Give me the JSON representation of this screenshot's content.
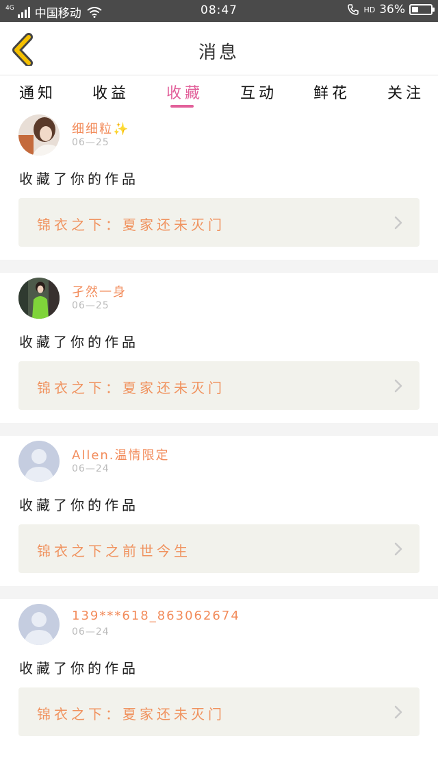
{
  "status_bar": {
    "network": "4G",
    "carrier": "中国移动",
    "time": "08:47",
    "hd": "HD",
    "battery_text": "36%",
    "battery_level": 0.36
  },
  "nav": {
    "title": "消息",
    "back_icon": "back-chevron-icon",
    "accent": "#f5c000"
  },
  "tabs": [
    {
      "label": "通知"
    },
    {
      "label": "收益"
    },
    {
      "label": "收藏",
      "active": true
    },
    {
      "label": "互动"
    },
    {
      "label": "鲜花"
    },
    {
      "label": "关注"
    }
  ],
  "colors": {
    "active_tab": "#e2609a",
    "username": "#f28b5a",
    "work_title": "#f0925e",
    "work_box_bg": "#f2f2ec"
  },
  "feed": [
    {
      "username": "细细粒✨",
      "date": "06—25",
      "action": "收藏了你的作品",
      "work_title": "锦衣之下：夏家还未灭门",
      "avatar": "photo-avatar-1"
    },
    {
      "username": "孑然一身",
      "date": "06—25",
      "action": "收藏了你的作品",
      "work_title": "锦衣之下：夏家还未灭门",
      "avatar": "photo-avatar-2"
    },
    {
      "username": "Allen.温情限定",
      "date": "06—24",
      "action": "收藏了你的作品",
      "work_title": "锦衣之下之前世今生",
      "avatar": "default-user-icon"
    },
    {
      "username": "139***618_863062674",
      "date": "06—24",
      "action": "收藏了你的作品",
      "work_title": "锦衣之下：夏家还未灭门",
      "avatar": "default-user-icon"
    }
  ]
}
